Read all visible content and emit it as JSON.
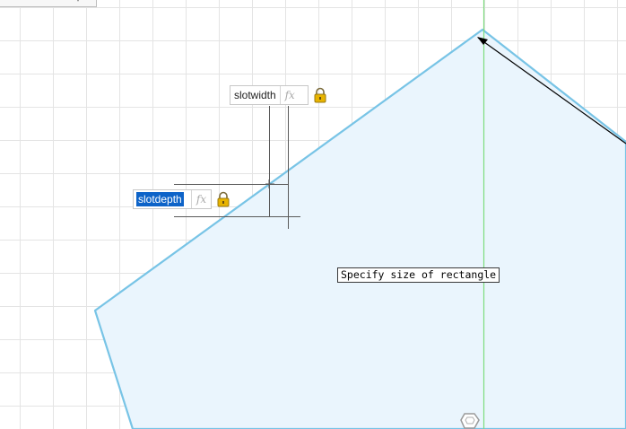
{
  "dimensions": {
    "slot_width": {
      "value": "slotwidth",
      "fx": "fx",
      "locked": true
    },
    "slot_depth": {
      "value": "slotdepth",
      "fx": "fx",
      "locked": true
    }
  },
  "tooltip": {
    "text": "Specify size of rectangle"
  },
  "icons": {
    "lock": "lock-icon",
    "fx": "fx-icon",
    "origin": "hexagon-origin-icon"
  },
  "colors": {
    "canvas": "#ffffff",
    "grid": "#e4e4e4",
    "profile_stroke": "#78c4e6",
    "profile_fill": "#eaf5fd",
    "axis_green": "#7ddc7d",
    "selection": "#0d63c8",
    "lock_gold": "#e8b400"
  }
}
